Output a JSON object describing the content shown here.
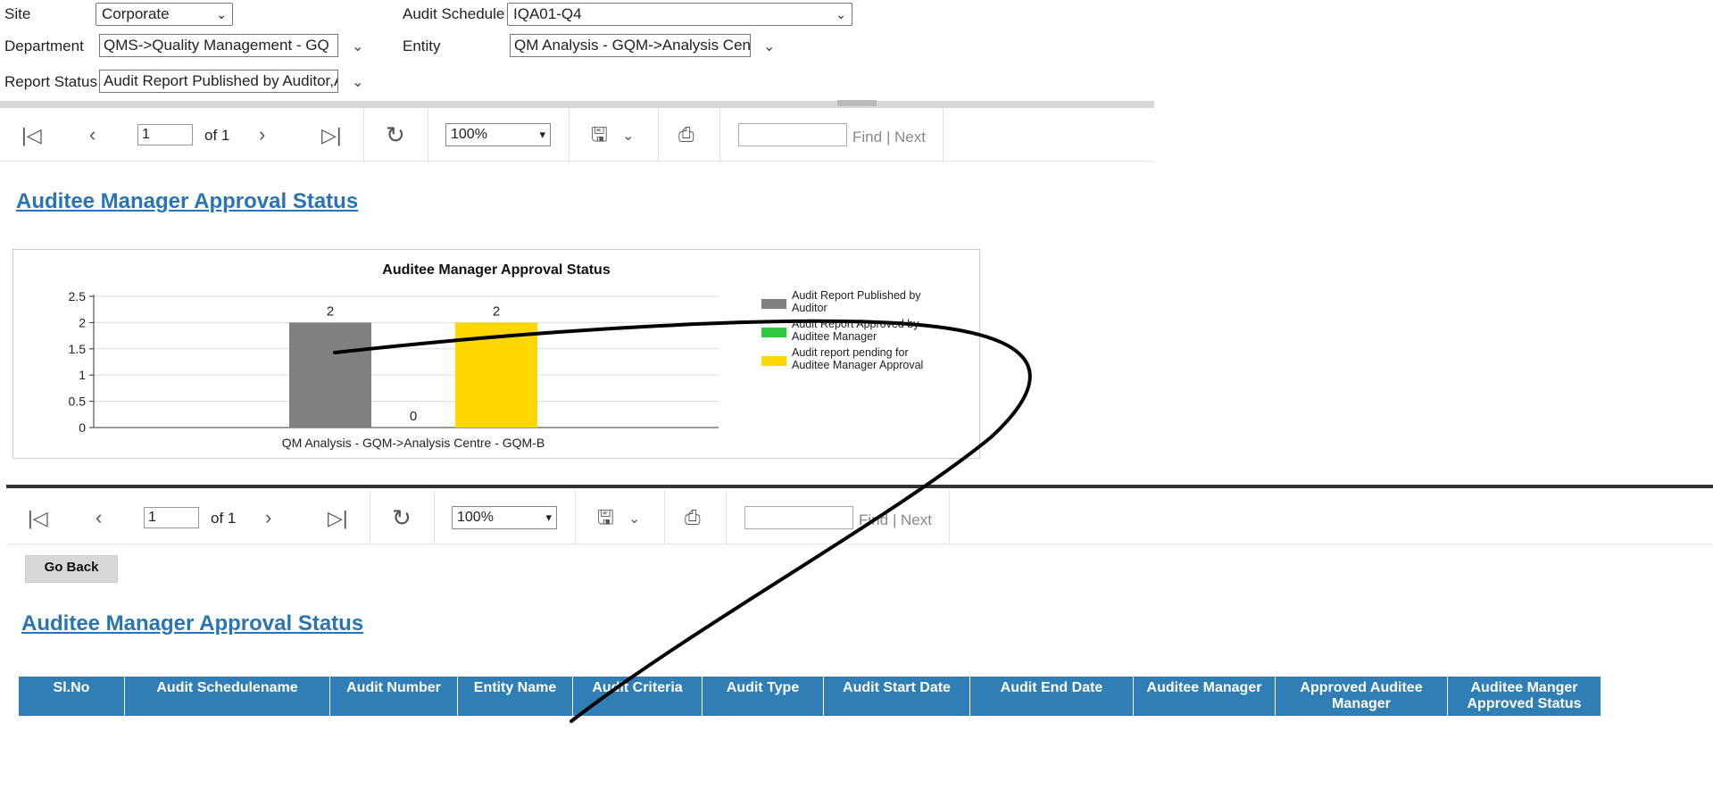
{
  "filters": {
    "site_label": "Site",
    "site_value": "Corporate",
    "department_label": "Department",
    "department_value": "QMS->Quality Management - GQ",
    "report_status_label": "Report Status",
    "report_status_value": "Audit Report Published by Auditor,A",
    "audit_schedule_label": "Audit Schedule",
    "audit_schedule_value": "IQA01-Q4",
    "entity_label": "Entity",
    "entity_value": "QM Analysis - GQM->Analysis Cent"
  },
  "toolbar": {
    "page_value": "1",
    "of_label": "of 1",
    "zoom_value": "100%",
    "find_label": "Find",
    "divider": "|",
    "next_label": "Next"
  },
  "report": {
    "title": "Auditee Manager Approval Status",
    "go_back_label": "Go Back",
    "bottom_title": "Auditee Manager Approval Status"
  },
  "chart_data": {
    "type": "bar",
    "title": "Auditee Manager Approval Status",
    "categories": [
      "QM Analysis - GQM->Analysis Centre - GQM-B"
    ],
    "series": [
      {
        "name": "Audit Report Published by Auditor",
        "values": [
          2
        ],
        "color": "#808080"
      },
      {
        "name": "Audit Report Approved by Auditee Manager",
        "values": [
          0
        ],
        "color": "#2ecc40"
      },
      {
        "name": "Audit report pending for Auditee Manager Approval",
        "values": [
          2
        ],
        "color": "#ffd700"
      }
    ],
    "yticks": [
      "0",
      "0.5",
      "1",
      "1.5",
      "2",
      "2.5"
    ],
    "ylim": [
      0,
      2.5
    ],
    "legend_position": "right",
    "grid": true
  },
  "table": {
    "columns": [
      "Sl.No",
      "Audit Schedulename",
      "Audit Number",
      "Entity Name",
      "Audit Criteria",
      "Audit Type",
      "Audit Start Date",
      "Audit End Date",
      "Auditee Manager",
      "Approved Auditee Manager",
      "Auditee Manger Approved Status"
    ]
  },
  "icons": {
    "first": "first-page-icon",
    "prev": "previous-page-icon",
    "next": "next-page-icon",
    "last": "last-page-icon",
    "refresh": "refresh-icon",
    "save": "save-icon",
    "print": "print-icon"
  },
  "colors": {
    "link_blue": "#2a74b5",
    "header_blue": "#2f7fb6"
  }
}
